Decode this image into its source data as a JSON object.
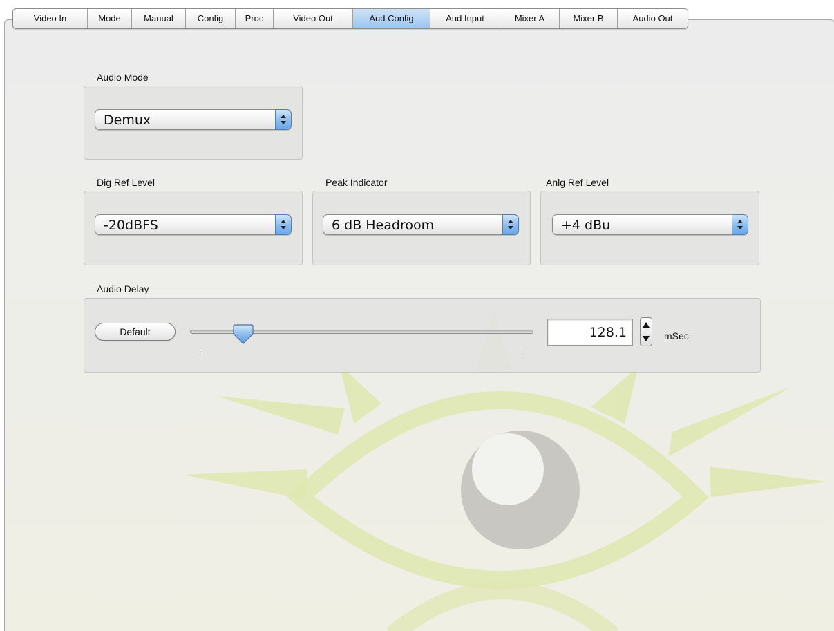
{
  "tabs": [
    {
      "label": "Video In",
      "active": false
    },
    {
      "label": "Mode",
      "active": false
    },
    {
      "label": "Manual",
      "active": false
    },
    {
      "label": "Config",
      "active": false
    },
    {
      "label": "Proc",
      "active": false
    },
    {
      "label": "Video Out",
      "active": false
    },
    {
      "label": "Aud Config",
      "active": true
    },
    {
      "label": "Aud Input",
      "active": false
    },
    {
      "label": "Mixer A",
      "active": false
    },
    {
      "label": "Mixer B",
      "active": false
    },
    {
      "label": "Audio Out",
      "active": false
    }
  ],
  "audio_mode": {
    "label": "Audio Mode",
    "value": "Demux"
  },
  "dig_ref_level": {
    "label": "Dig Ref Level",
    "value": "-20dBFS"
  },
  "peak_indicator": {
    "label": "Peak Indicator",
    "value": "6 dB Headroom"
  },
  "anlg_ref_level": {
    "label": "Anlg Ref Level",
    "value": "+4 dBu"
  },
  "audio_delay": {
    "label": "Audio Delay",
    "default_button": "Default",
    "value": "128.1",
    "unit": "mSec",
    "slider_fraction": 0.15
  },
  "colors": {
    "accent": "#8fbff0",
    "active_tab": "#b8d5f4",
    "watermark_green": "#dfe7b0",
    "watermark_gray": "#c9c7c2"
  },
  "icons": {
    "popup": "up-down-chevron-icon",
    "stepper": "stepper-arrows-icon",
    "watermark": "eye-logo-watermark"
  }
}
